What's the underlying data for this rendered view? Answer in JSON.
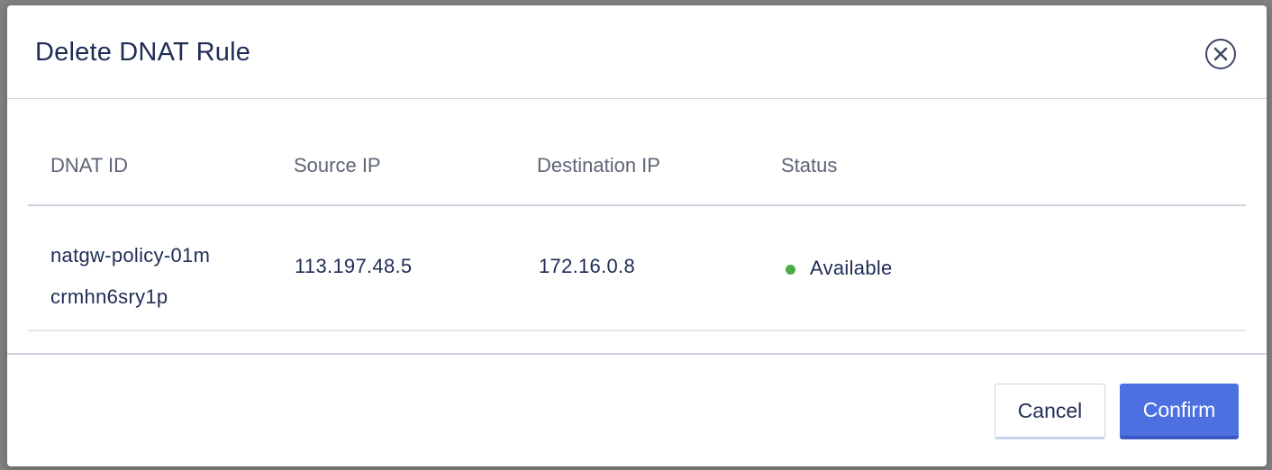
{
  "dialog": {
    "title": "Delete DNAT Rule",
    "close_icon": "close-circle-icon"
  },
  "table": {
    "columns": [
      "DNAT ID",
      "Source IP",
      "Destination IP",
      "Status"
    ],
    "rows": [
      {
        "dnat_id_line1": "natgw-policy-01m",
        "dnat_id_line2": "crmhn6sry1p",
        "source_ip": "113.197.48.5",
        "destination_ip": "172.16.0.8",
        "status": "Available",
        "status_color": "#4aaa45"
      }
    ]
  },
  "footer": {
    "cancel_label": "Cancel",
    "confirm_label": "Confirm"
  },
  "colors": {
    "primary": "#4d70e0",
    "text": "#1f2d56",
    "muted": "#5e6577"
  }
}
